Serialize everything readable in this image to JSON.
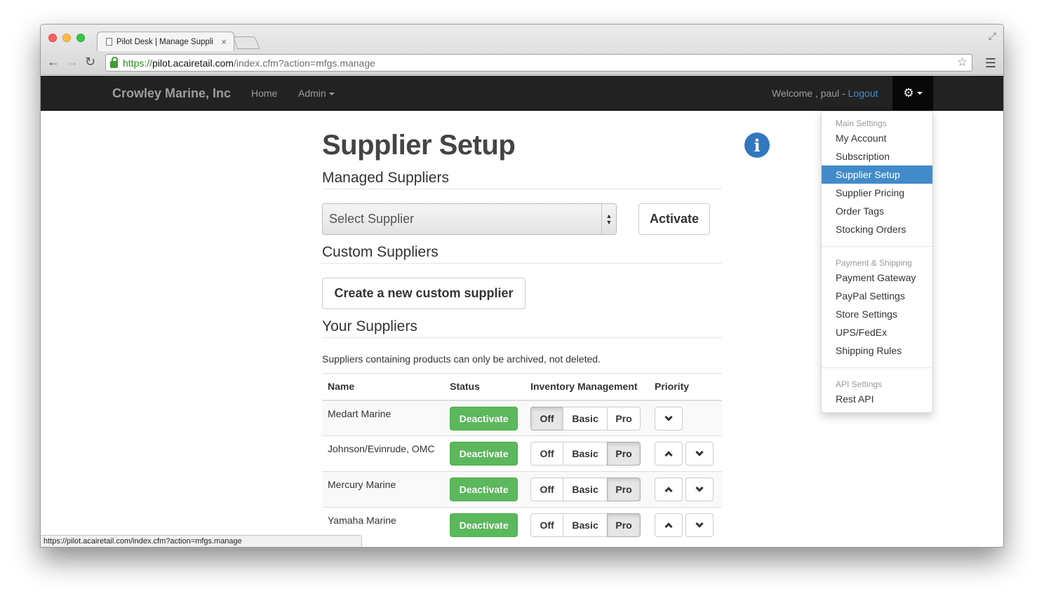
{
  "browser": {
    "tab_title": "Pilot Desk | Manage Suppli",
    "tab_close": "×",
    "url_scheme": "https://",
    "url_host": "pilot.acairetail.com",
    "url_path": "/index.cfm?action=mfgs.manage",
    "status_url": "https://pilot.acairetail.com/index.cfm?action=mfgs.manage"
  },
  "navbar": {
    "brand": "Crowley Marine, Inc",
    "home": "Home",
    "admin": "Admin",
    "welcome": "Welcome , paul - ",
    "logout": "Logout"
  },
  "page": {
    "title": "Supplier Setup",
    "managed_heading": "Managed Suppliers",
    "select_placeholder": "Select Supplier",
    "activate_label": "Activate",
    "custom_heading": "Custom Suppliers",
    "create_label": "Create a new custom supplier",
    "your_heading": "Your Suppliers",
    "help_text": "Suppliers containing products can only be archived, not deleted."
  },
  "table": {
    "headers": [
      "Name",
      "Status",
      "Inventory Management",
      "Priority"
    ],
    "deactivate_label": "Deactivate",
    "inv_options": [
      "Off",
      "Basic",
      "Pro"
    ],
    "rows": [
      {
        "name": "Medart Marine",
        "inventory": "Off"
      },
      {
        "name": "Johnson/Evinrude, OMC",
        "inventory": "Pro"
      },
      {
        "name": "Mercury Marine",
        "inventory": "Pro"
      },
      {
        "name": "Yamaha Marine",
        "inventory": "Pro"
      }
    ]
  },
  "dropdown": {
    "main_header": "Main Settings",
    "main_items": [
      "My Account",
      "Subscription",
      "Supplier Setup",
      "Supplier Pricing",
      "Order Tags",
      "Stocking Orders"
    ],
    "payment_header": "Payment & Shipping",
    "payment_items": [
      "Payment Gateway",
      "PayPal Settings",
      "Store Settings",
      "UPS/FedEx",
      "Shipping Rules"
    ],
    "api_header": "API Settings",
    "api_items": [
      "Rest API"
    ]
  },
  "colors": {
    "navbar_bg": "#222222",
    "accent_blue": "#428bca",
    "success_green": "#5cb85c"
  }
}
